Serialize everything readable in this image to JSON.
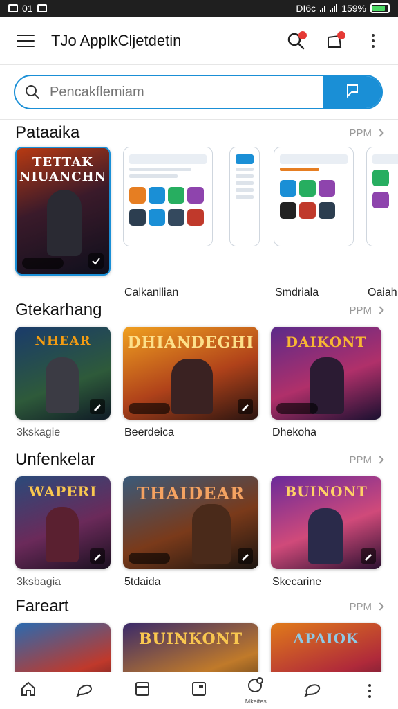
{
  "status_bar": {
    "left_text": "01",
    "middle_text": "DI6c",
    "battery_text": "159%",
    "battery_level": 0.85
  },
  "app_bar": {
    "title": "TJo ApplkCljetdetin",
    "menu_icon": "hamburger-icon",
    "search_icon": "search-icon",
    "notification_icon": "notification-icon",
    "more_icon": "kebab-icon"
  },
  "search": {
    "placeholder": "Pencakflemiam",
    "button_icon": "flag-icon",
    "accent": "#1a8fd6"
  },
  "sections": [
    {
      "title": "Pataaika",
      "more_label": "PPM",
      "items": [
        {
          "caption": "",
          "art_text": "TETTAK NIUANCHN",
          "kind": "game"
        },
        {
          "caption": "Calkanllian",
          "kind": "phone"
        },
        {
          "caption": "",
          "kind": "phone-small"
        },
        {
          "caption": "Smdriala",
          "kind": "phone"
        },
        {
          "caption": "Oaiah",
          "kind": "phone"
        }
      ]
    },
    {
      "title": "Gtekarhang",
      "more_label": "PPM",
      "items": [
        {
          "caption": "3kskagie",
          "art_text": "NHEAR",
          "kind": "game"
        },
        {
          "caption": "Beerdeica",
          "art_text": "DHIANDEGHI",
          "kind": "game"
        },
        {
          "caption": "Dhekoha",
          "art_text": "DAIKONT",
          "kind": "game"
        }
      ]
    },
    {
      "title": "Unfenkelar",
      "more_label": "PPM",
      "items": [
        {
          "caption": "3ksbagia",
          "art_text": "WAPERI",
          "kind": "game"
        },
        {
          "caption": "5tdaida",
          "art_text": "THAIDEAR",
          "kind": "game"
        },
        {
          "caption": "Skecarine",
          "art_text": "BUINONT",
          "kind": "game"
        }
      ]
    },
    {
      "title": "Fareart",
      "more_label": "PPM",
      "items": [
        {
          "caption": "",
          "art_text": "",
          "kind": "game"
        },
        {
          "caption": "",
          "art_text": "BUINKONT",
          "kind": "game"
        },
        {
          "caption": "",
          "art_text": "APAIOK",
          "kind": "game"
        }
      ]
    }
  ],
  "bottom_nav": {
    "items": [
      {
        "icon": "home-icon",
        "label": ""
      },
      {
        "icon": "chat-icon",
        "label": ""
      },
      {
        "icon": "inbox-icon",
        "label": ""
      },
      {
        "icon": "calendar-icon",
        "label": ""
      },
      {
        "icon": "profile-icon",
        "label": "Mkeites"
      },
      {
        "icon": "comment-icon",
        "label": ""
      },
      {
        "icon": "more-icon",
        "label": ""
      }
    ]
  }
}
